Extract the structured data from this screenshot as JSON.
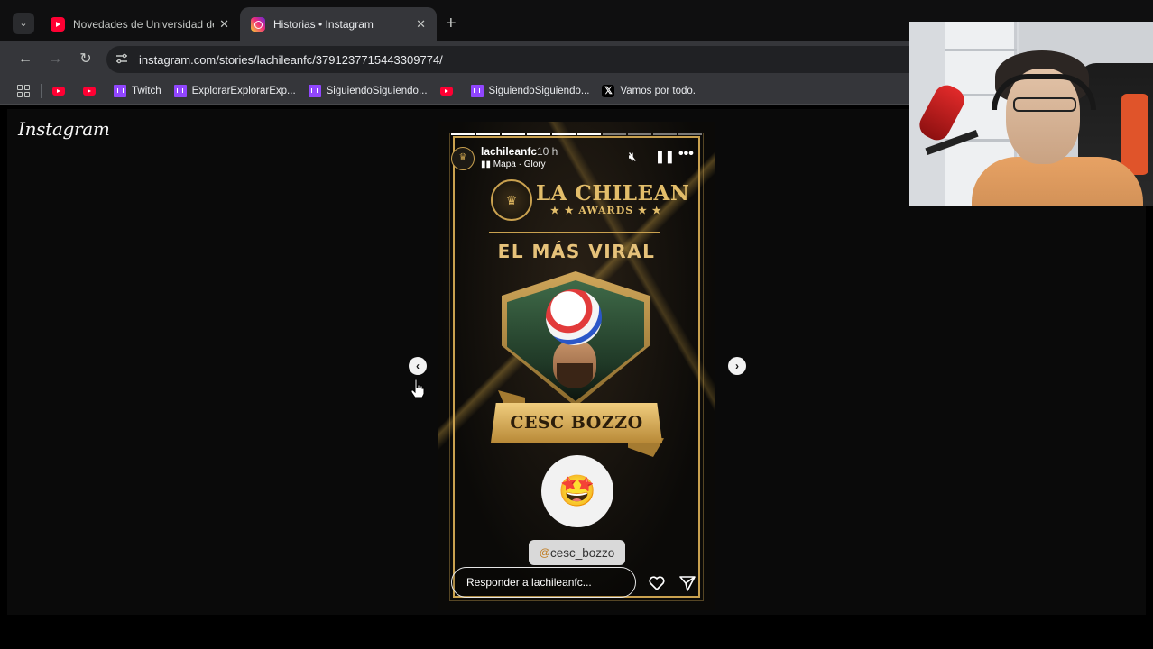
{
  "browser": {
    "tabs": [
      {
        "title": "Novedades de Universidad de C",
        "favicon": "youtube-icon",
        "active": false
      },
      {
        "title": "Historias • Instagram",
        "favicon": "instagram-icon",
        "active": true
      }
    ],
    "new_tab_label": "+",
    "address": "instagram.com/stories/lachileanfc/3791237715443309774/",
    "bookmarks": [
      {
        "label": "",
        "icon": "youtube-icon"
      },
      {
        "label": "",
        "icon": "youtube-icon"
      },
      {
        "label": "Twitch",
        "icon": "twitch-icon"
      },
      {
        "label": "ExplorarExplorarExp...",
        "icon": "twitch-icon"
      },
      {
        "label": "SiguiendoSiguiendo...",
        "icon": "twitch-icon"
      },
      {
        "label": "",
        "icon": "youtube-icon"
      },
      {
        "label": "SiguiendoSiguiendo...",
        "icon": "twitch-icon"
      },
      {
        "label": "Vamos por todo.",
        "icon": "x-icon"
      }
    ]
  },
  "instagram": {
    "logo": "Instagram",
    "story": {
      "username": "lachileanfc",
      "time": "10 h",
      "music": "Mapa · Glory",
      "progress_segments_total": 10,
      "progress_segments_done": 6,
      "brand": "LA CHILEAN",
      "brand_sub": "★ ★ AWARDS ★ ★",
      "category": "EL MÁS VIRAL",
      "player_name": "CESC BOZZO",
      "emoji": "🤩",
      "mention_at": "@",
      "mention": "cesc_bozzo",
      "reply_placeholder": "Responder a lachileanfc..."
    }
  },
  "colors": {
    "gold": "#c9a14f",
    "chrome_bg": "#35363a",
    "page_bg": "#0a0a0a"
  }
}
